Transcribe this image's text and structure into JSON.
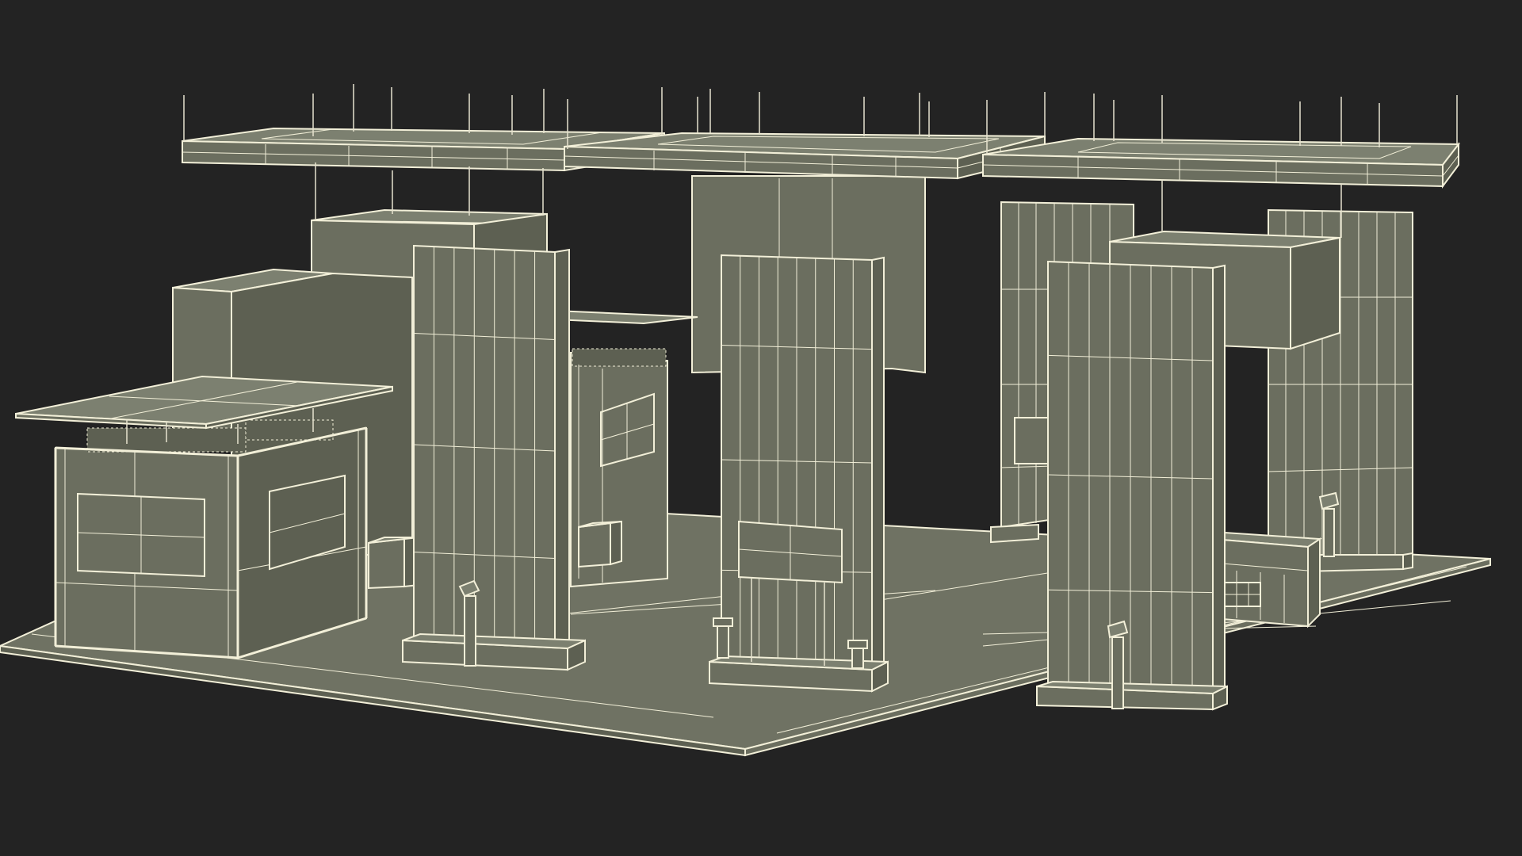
{
  "viewport": {
    "background_color": "#232323"
  },
  "scene": {
    "object": "exhibition-stand-wireframe",
    "colors": {
      "fill_floor": "#6f7263",
      "fill_top": "#7c8070",
      "fill_left": "#6b6e5f",
      "fill_right": "#5d6052",
      "wire": "#f2efd8",
      "rod": "#e6e3cf"
    },
    "parts": [
      "floor",
      "left-booth",
      "rear-wall-block",
      "rear-cube",
      "center-booth",
      "hanging-banner-frames",
      "tall-pillars",
      "rear-right-screens",
      "front-right-counter",
      "info-kiosks"
    ]
  }
}
